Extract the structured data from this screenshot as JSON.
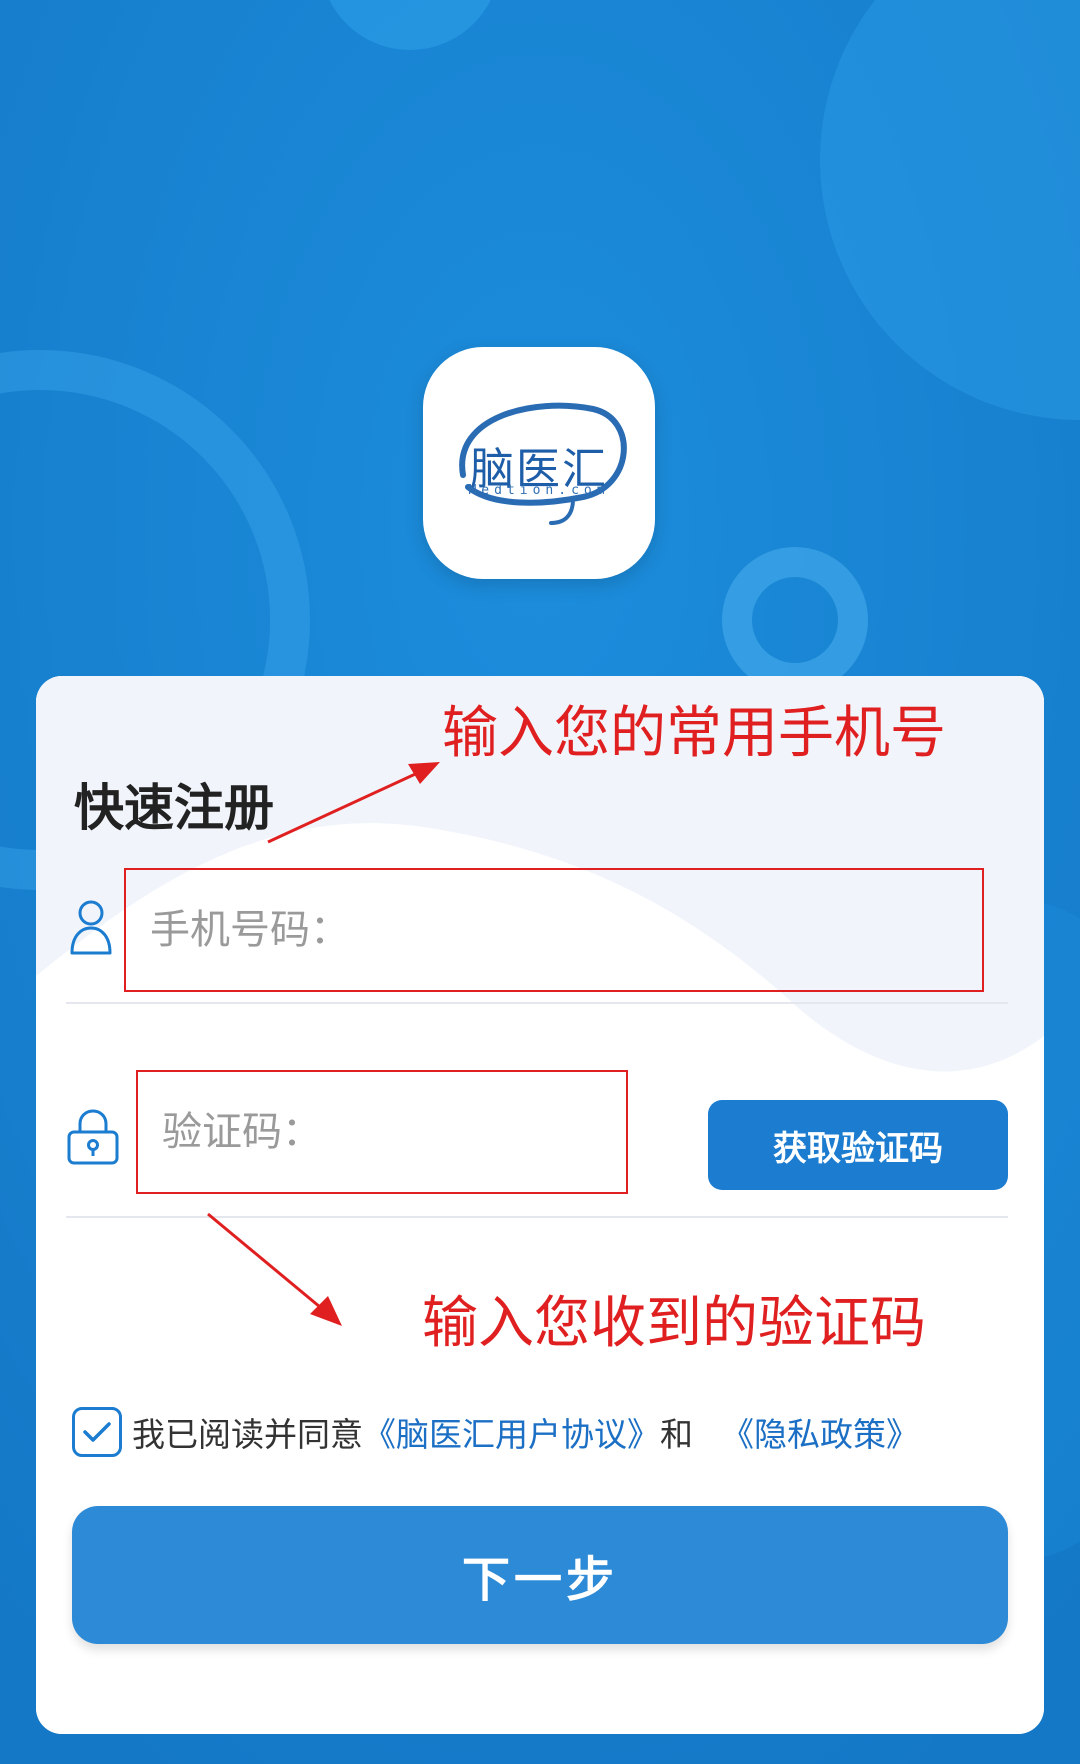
{
  "logo": {
    "name_cn": "脑医汇",
    "name_en": "Medtion.com"
  },
  "form": {
    "title": "快速注册",
    "phone_placeholder": "手机号码：",
    "code_placeholder": "验证码：",
    "get_code_label": "获取验证码"
  },
  "annotations": {
    "phone_hint": "输入您的常用手机号",
    "code_hint": "输入您收到的验证码"
  },
  "agreement": {
    "checked": true,
    "prefix": "我已阅读并同意",
    "user_agreement": "《脑医汇用户协议》",
    "and": "和",
    "privacy_policy": "《隐私政策》"
  },
  "next_button": "下一步",
  "icons": {
    "phone_field": "user-icon",
    "code_field": "lock-icon",
    "checkbox": "check-icon"
  },
  "colors": {
    "background": "#1b86d6",
    "primary_button": "#2d8ad6",
    "link": "#1b6fc4",
    "annotation": "#e02020"
  }
}
